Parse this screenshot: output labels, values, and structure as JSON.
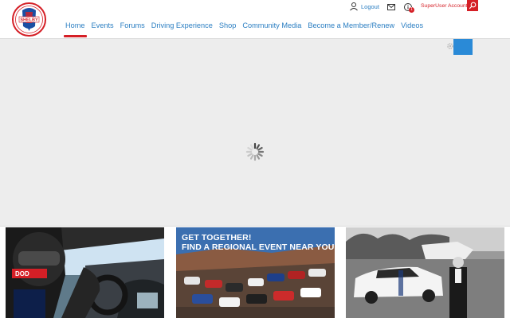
{
  "header": {
    "logo_alt": "SHELBY",
    "nav": [
      {
        "label": "Home",
        "active": true
      },
      {
        "label": "Events"
      },
      {
        "label": "Forums"
      },
      {
        "label": "Driving Experience"
      },
      {
        "label": "Shop"
      },
      {
        "label": "Community Media"
      },
      {
        "label": "Become a Member/Renew"
      },
      {
        "label": "Videos"
      }
    ],
    "logout_label": "Logout",
    "notification_count": "1",
    "account_label": "SuperUser Account"
  },
  "hero": {
    "state": "loading"
  },
  "cards": [
    {
      "id": "racing-driver",
      "title_line1": "",
      "title_line2": ""
    },
    {
      "id": "regional-events",
      "title_line1": "GET TOGETHER!",
      "title_line2": "FIND A REGIONAL EVENT NEAR YOU"
    },
    {
      "id": "classic-shelby",
      "title_line1": "",
      "title_line2": ""
    }
  ],
  "colors": {
    "brand_red": "#d51f26",
    "link_blue": "#2a7ec2",
    "hero_bg": "#ededed"
  }
}
